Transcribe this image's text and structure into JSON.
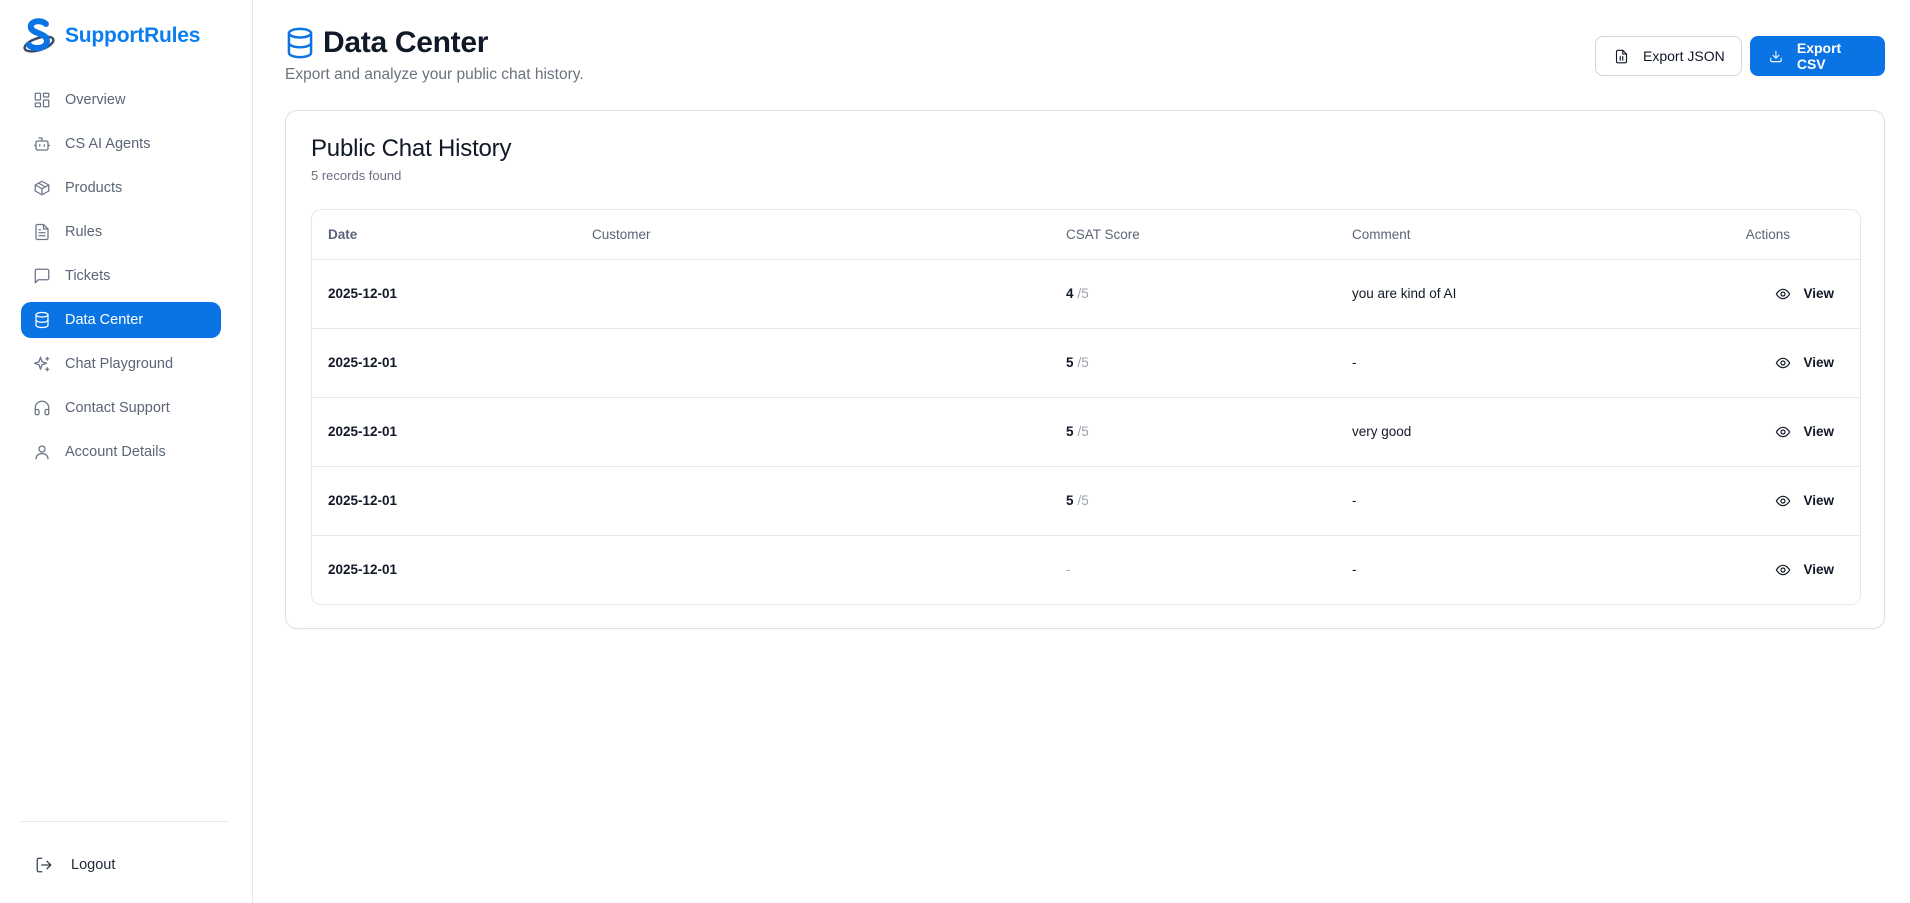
{
  "brand": {
    "name": "SupportRules",
    "logo_icon": "s-logo-icon",
    "accent": "#0b74e5"
  },
  "nav": {
    "items": [
      {
        "label": "Overview",
        "icon": "grid-icon",
        "active": false
      },
      {
        "label": "CS AI Agents",
        "icon": "bot-icon",
        "active": false
      },
      {
        "label": "Products",
        "icon": "box-icon",
        "active": false
      },
      {
        "label": "Rules",
        "icon": "document-icon",
        "active": false
      },
      {
        "label": "Tickets",
        "icon": "chat-icon",
        "active": false
      },
      {
        "label": "Data Center",
        "icon": "database-icon",
        "active": true
      },
      {
        "label": "Chat Playground",
        "icon": "sparkles-icon",
        "active": false
      },
      {
        "label": "Contact Support",
        "icon": "headset-icon",
        "active": false
      },
      {
        "label": "Account Details",
        "icon": "user-icon",
        "active": false
      }
    ],
    "logout_label": "Logout"
  },
  "header": {
    "title": "Data Center",
    "subtitle": "Export and analyze your public chat history.",
    "export_json_label": "Export JSON",
    "export_csv_label": "Export CSV"
  },
  "card": {
    "title": "Public Chat History",
    "subtitle": "5 records found"
  },
  "table": {
    "columns": [
      "Date",
      "Customer",
      "CSAT Score",
      "Comment",
      "Actions"
    ],
    "rows": [
      {
        "date": "2025-12-01",
        "customer": "",
        "score": "4",
        "score_den": "/5",
        "comment": "you are kind of AI",
        "action": "View"
      },
      {
        "date": "2025-12-01",
        "customer": "",
        "score": "5",
        "score_den": "/5",
        "comment": "-",
        "action": "View"
      },
      {
        "date": "2025-12-01",
        "customer": "",
        "score": "5",
        "score_den": "/5",
        "comment": "very good",
        "action": "View"
      },
      {
        "date": "2025-12-01",
        "customer": "",
        "score": "5",
        "score_den": "/5",
        "comment": "-",
        "action": "View"
      },
      {
        "date": "2025-12-01",
        "customer": "",
        "score": "-",
        "score_den": "",
        "comment": "-",
        "action": "View"
      }
    ]
  }
}
